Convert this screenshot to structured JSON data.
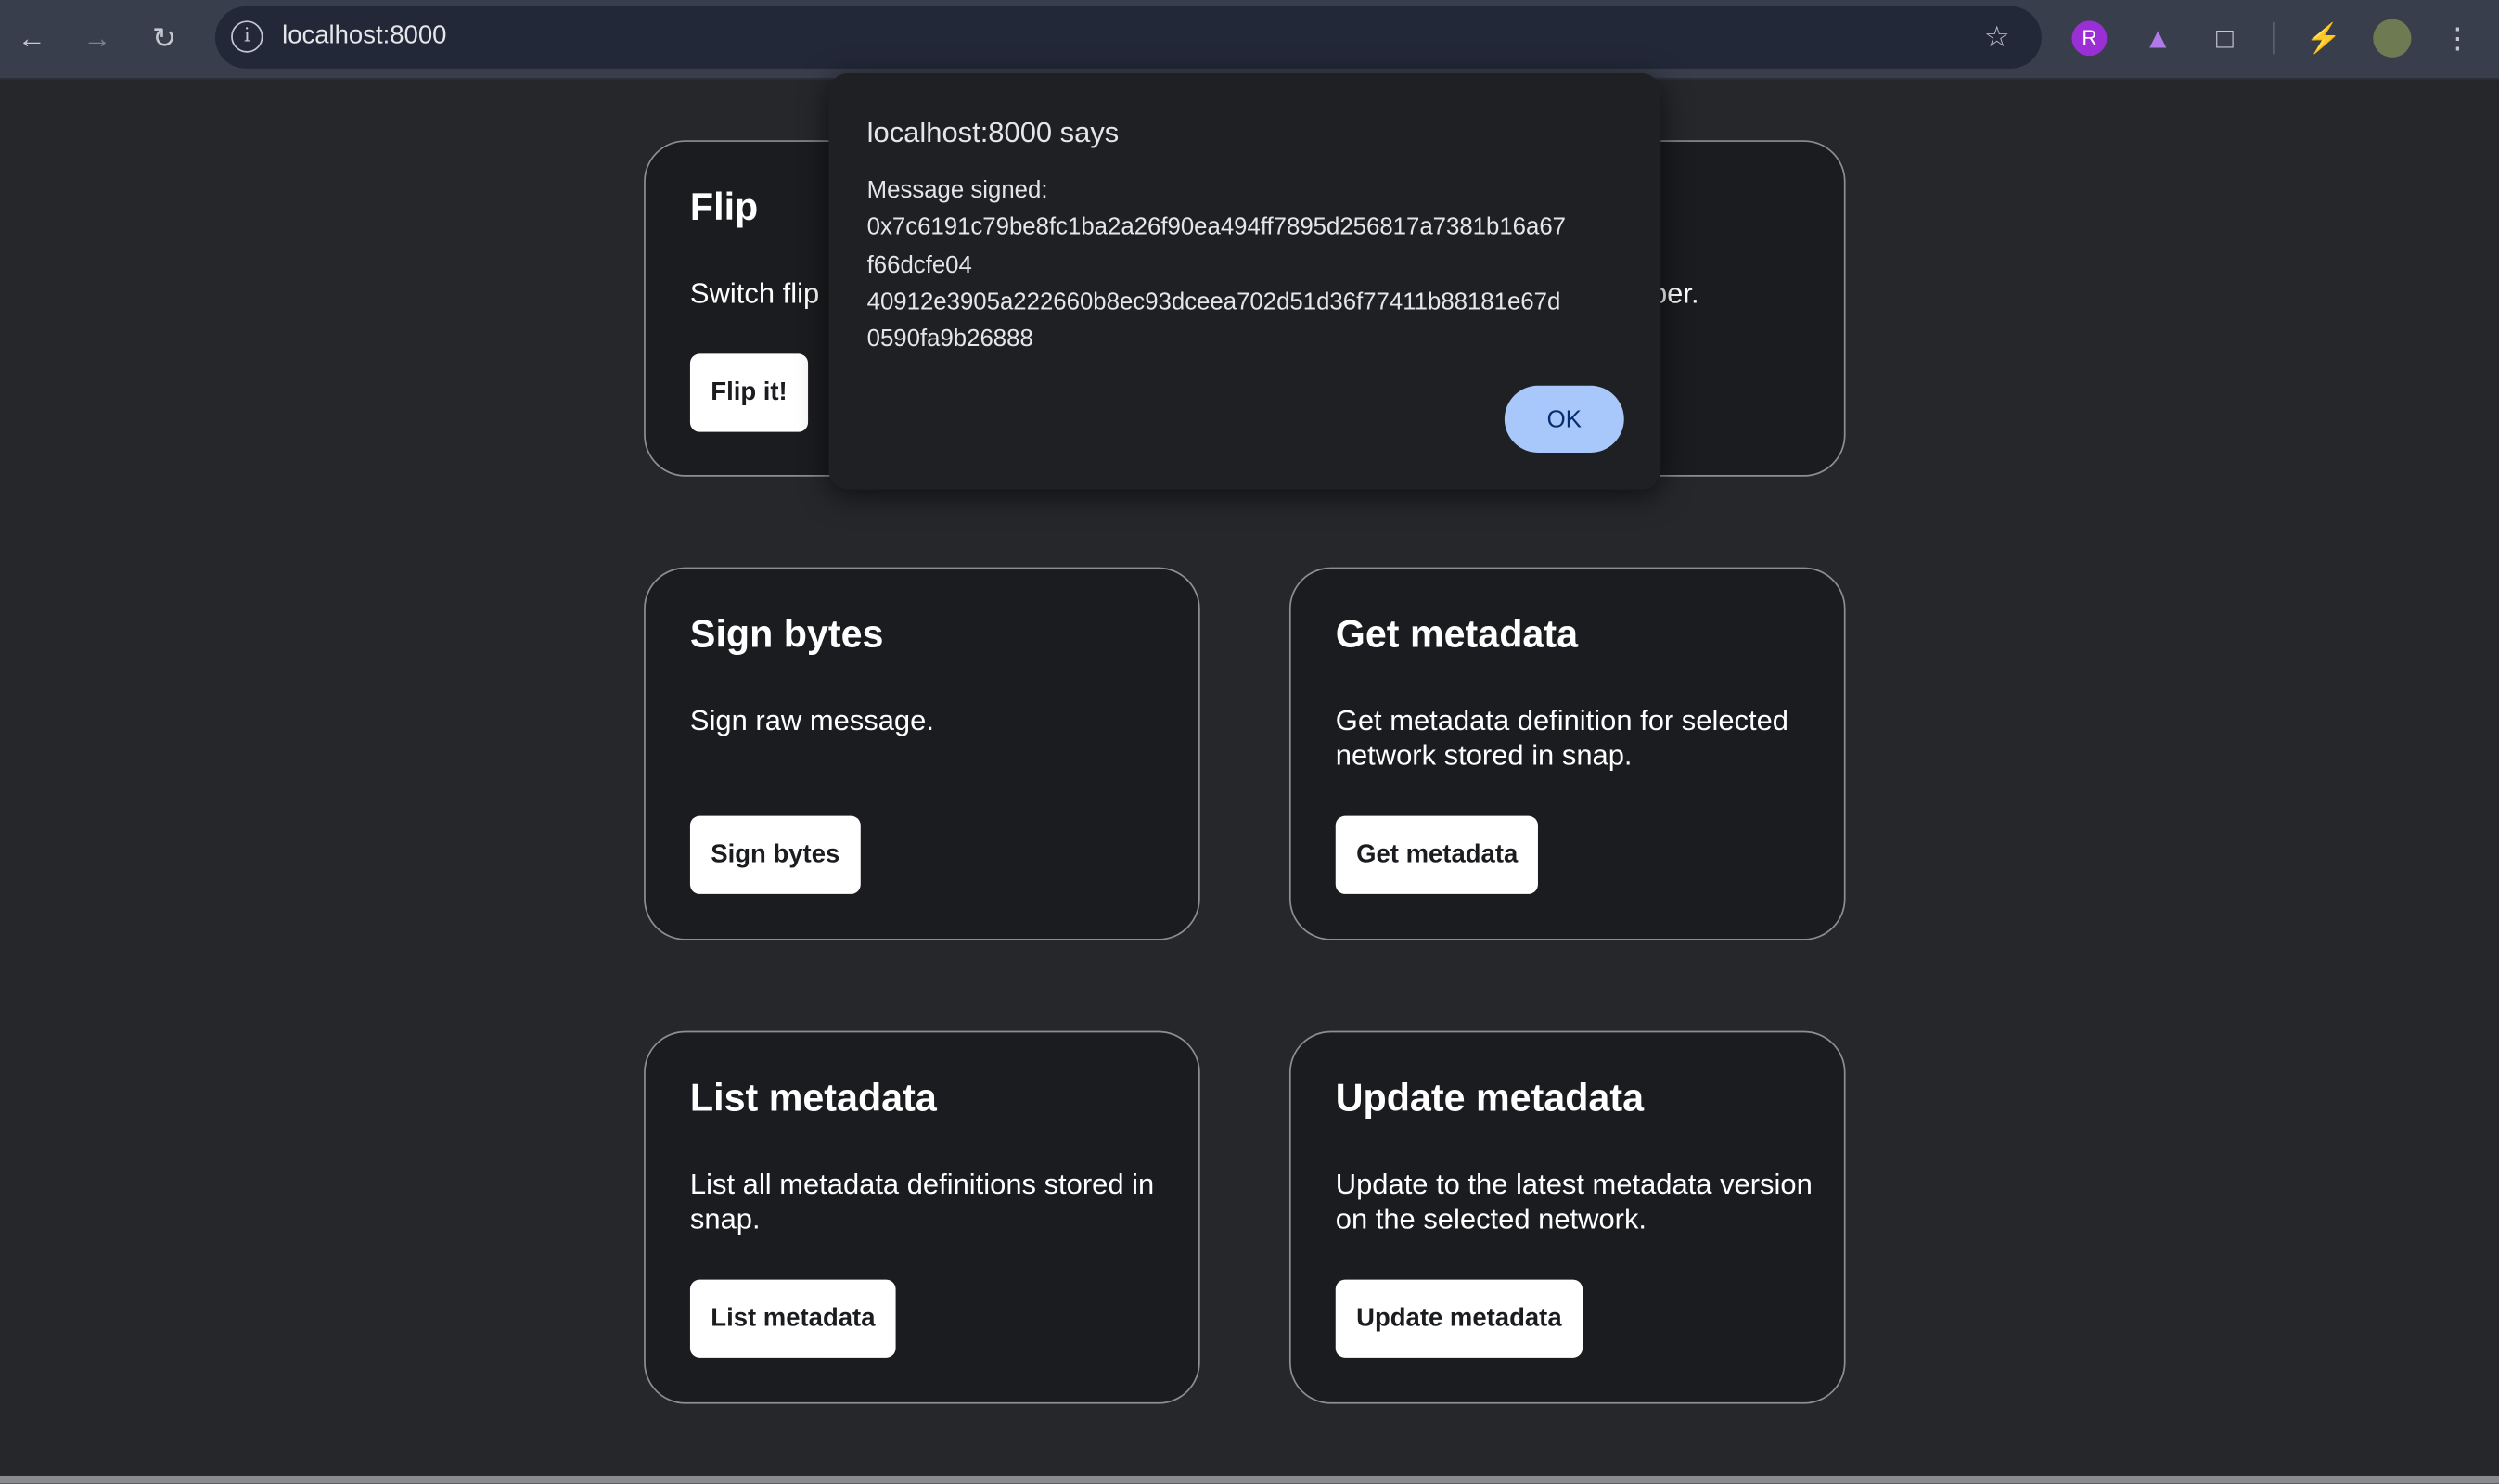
{
  "browser": {
    "url": "localhost:8000",
    "icons": [
      "back-icon",
      "forward-icon",
      "reload-icon",
      "site-info-icon",
      "bookmark-star-icon",
      "extension-r-icon",
      "metamask-fox-icon",
      "extensions-puzzle-icon",
      "performance-icon",
      "profile-avatar",
      "menu-kebab-icon"
    ]
  },
  "cards": [
    {
      "title": "Flip",
      "description": "Switch flip",
      "button": "Flip it!"
    },
    {
      "title": "",
      "description": "ber.",
      "button": ""
    },
    {
      "title": "Sign bytes",
      "description": "Sign raw message.",
      "button": "Sign bytes"
    },
    {
      "title": "Get metadata",
      "description": "Get metadata definition for selected network stored in snap.",
      "button": "Get metadata"
    },
    {
      "title": "List metadata",
      "description": "List all metadata definitions stored in snap.",
      "button": "List metadata"
    },
    {
      "title": "Update metadata",
      "description": "Update to the latest metadata version on the selected network.",
      "button": "Update metadata"
    }
  ],
  "dialog": {
    "title": "localhost:8000 says",
    "label": "Message signed:",
    "line1": "0x7c6191c79be8fc1ba2a26f90ea494ff7895d256817a7381b16a67",
    "line2": "f66dcfe04",
    "line3": "40912e3905a222660b8ec93dceea702d51d36f77411b88181e67d",
    "line4": "0590fa9b26888",
    "ok": "OK"
  },
  "colors": {
    "accent": "#a8c7fa",
    "card_bg": "#1b1c1f",
    "page_bg": "#26272b"
  }
}
